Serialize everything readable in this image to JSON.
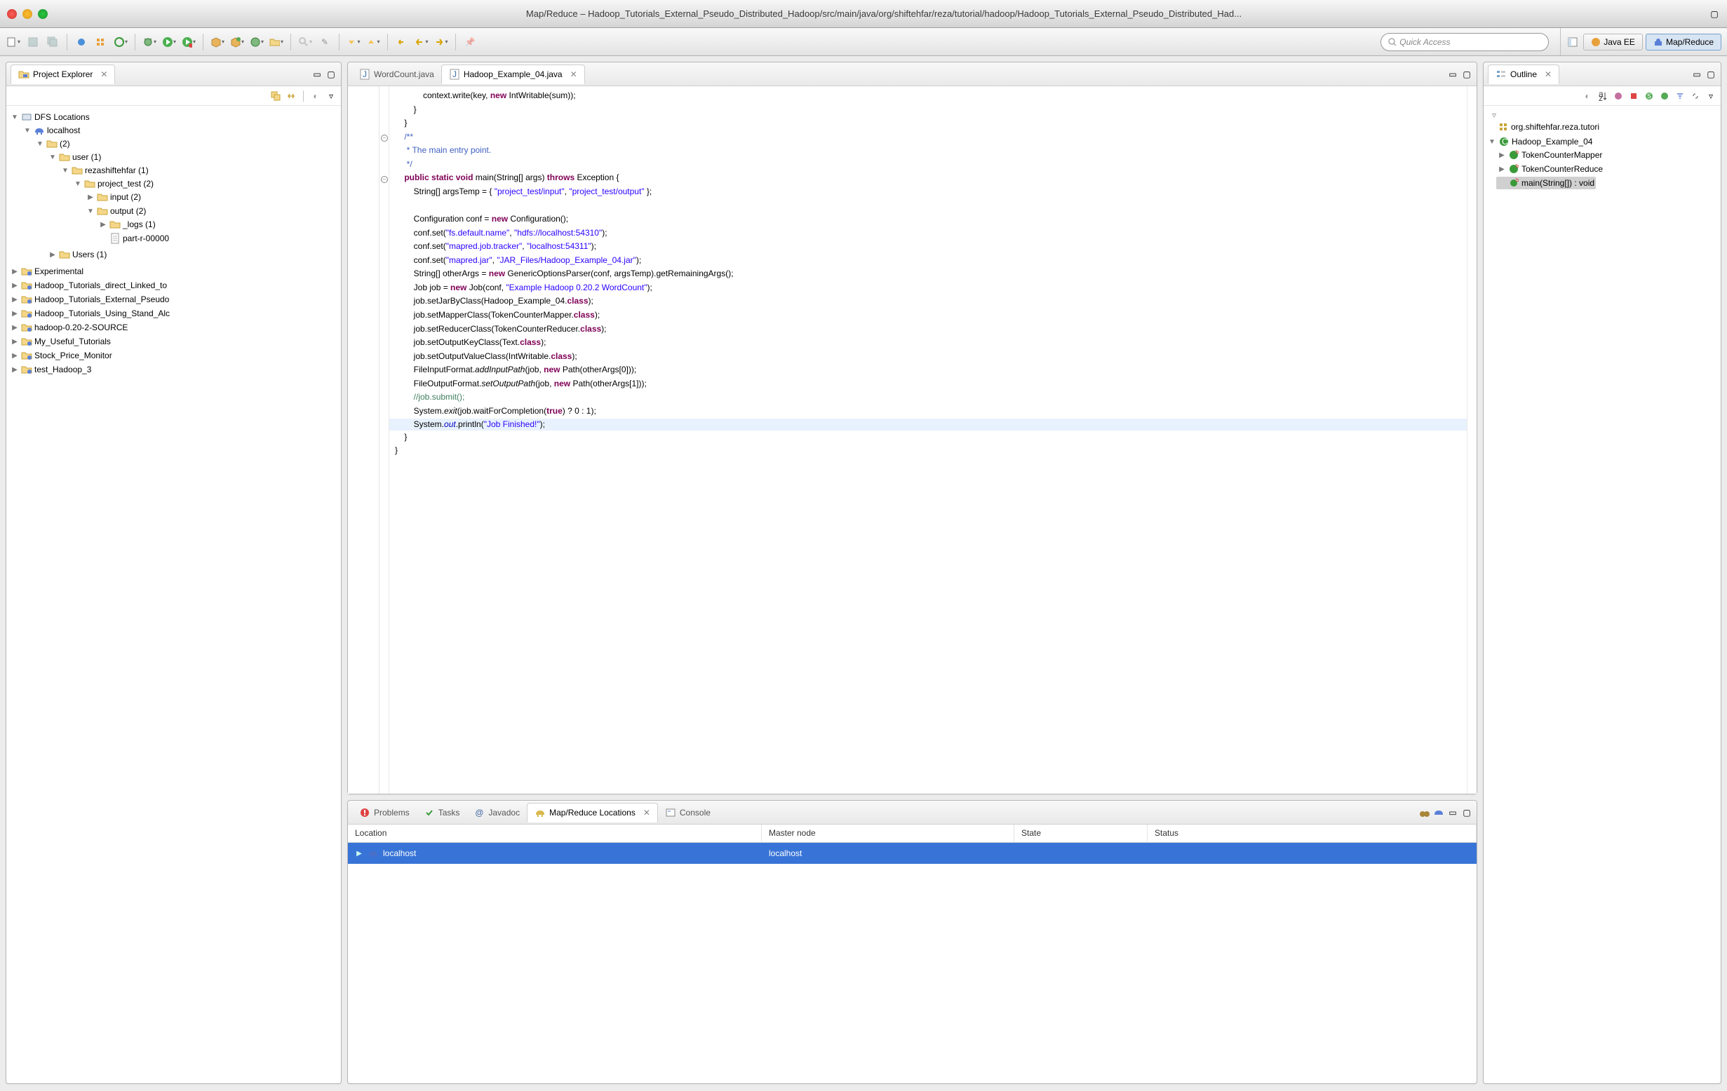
{
  "window": {
    "title": "Map/Reduce – Hadoop_Tutorials_External_Pseudo_Distributed_Hadoop/src/main/java/org/shiftehfar/reza/tutorial/hadoop/Hadoop_Tutorials_External_Pseudo_Distributed_Had..."
  },
  "quick_access": {
    "placeholder": "Quick Access"
  },
  "perspectives": [
    {
      "name": "Java EE"
    },
    {
      "name": "Map/Reduce"
    }
  ],
  "project_explorer": {
    "title": "Project Explorer",
    "dfs": "DFS Locations",
    "localhost": "localhost",
    "n2": "(2)",
    "user": "user (1)",
    "rez": "rezashiftehfar (1)",
    "proj": "project_test (2)",
    "input": "input (2)",
    "output": "output (2)",
    "logs": "_logs (1)",
    "part": "part-r-00000",
    "users": "Users (1)",
    "exp": "Experimental",
    "p1": "Hadoop_Tutorials_direct_Linked_to",
    "p2": "Hadoop_Tutorials_External_Pseudo",
    "p3": "Hadoop_Tutorials_Using_Stand_Alc",
    "p4": "hadoop-0.20-2-SOURCE",
    "p5": "My_Useful_Tutorials",
    "p6": "Stock_Price_Monitor",
    "p7": "test_Hadoop_3"
  },
  "editors": {
    "tab1": "WordCount.java",
    "tab2": "Hadoop_Example_04.java"
  },
  "code": {
    "l1a": "            context.write(key, ",
    "l1b": "new",
    "l1c": " IntWritable(sum));",
    "l2": "        }",
    "l3": "    }",
    "l4": "    /**",
    "l5": "     * The main entry point.",
    "l6": "     */",
    "l7a": "    ",
    "l7b": "public",
    "l7c": " ",
    "l7d": "static",
    "l7e": " ",
    "l7f": "void",
    "l7g": " main(String[] args) ",
    "l7h": "throws",
    "l7i": " Exception {",
    "l8a": "        String[] argsTemp = { ",
    "l8b": "\"project_test/input\"",
    "l8c": ", ",
    "l8d": "\"project_test/output\"",
    "l8e": " };",
    "l9": "",
    "l10a": "        Configuration conf = ",
    "l10b": "new",
    "l10c": " Configuration();",
    "l11a": "        conf.set(",
    "l11b": "\"fs.default.name\"",
    "l11c": ", ",
    "l11d": "\"hdfs://localhost:54310\"",
    "l11e": ");",
    "l12a": "        conf.set(",
    "l12b": "\"mapred.job.tracker\"",
    "l12c": ", ",
    "l12d": "\"localhost:54311\"",
    "l12e": ");",
    "l13a": "        conf.set(",
    "l13b": "\"mapred.jar\"",
    "l13c": ", ",
    "l13d": "\"JAR_Files/Hadoop_Example_04.jar\"",
    "l13e": ");",
    "l14a": "        String[] otherArgs = ",
    "l14b": "new",
    "l14c": " GenericOptionsParser(conf, argsTemp).getRemainingArgs();",
    "l15a": "        Job job = ",
    "l15b": "new",
    "l15c": " Job(conf, ",
    "l15d": "\"Example Hadoop 0.20.2 WordCount\"",
    "l15e": ");",
    "l16a": "        job.setJarByClass(Hadoop_Example_04.",
    "l16b": "class",
    "l16c": ");",
    "l17a": "        job.setMapperClass(TokenCounterMapper.",
    "l17b": "class",
    "l17c": ");",
    "l18a": "        job.setReducerClass(TokenCounterReducer.",
    "l18b": "class",
    "l18c": ");",
    "l19a": "        job.setOutputKeyClass(Text.",
    "l19b": "class",
    "l19c": ");",
    "l20a": "        job.setOutputValueClass(IntWritable.",
    "l20b": "class",
    "l20c": ");",
    "l21a": "        FileInputFormat.",
    "l21m": "addInputPath",
    "l21b": "(job, ",
    "l21c": "new",
    "l21d": " Path(otherArgs[0]));",
    "l22a": "        FileOutputFormat.",
    "l22m": "setOutputPath",
    "l22b": "(job, ",
    "l22c": "new",
    "l22d": " Path(otherArgs[1]));",
    "l23": "        //job.submit();",
    "l24a": "        System.",
    "l24m": "exit",
    "l24b": "(job.waitForCompletion(",
    "l24c": "true",
    "l24d": ") ? 0 : 1);",
    "l25a": "        System.",
    "l25f": "out",
    "l25b": ".println(",
    "l25c": "\"Job Finished!\"",
    "l25d": ");",
    "l26": "    }",
    "l27": "}"
  },
  "bottom": {
    "tabs": {
      "problems": "Problems",
      "tasks": "Tasks",
      "javadoc": "Javadoc",
      "mr": "Map/Reduce Locations",
      "console": "Console"
    },
    "cols": {
      "loc": "Location",
      "master": "Master node",
      "state": "State",
      "status": "Status"
    },
    "row": {
      "loc": "localhost",
      "master": "localhost"
    }
  },
  "outline": {
    "title": "Outline",
    "pkg": "org.shiftehfar.reza.tutori",
    "cls": "Hadoop_Example_04",
    "m1": "TokenCounterMapper",
    "m2": "TokenCounterReduce",
    "m3": "main(String[]) : void"
  }
}
